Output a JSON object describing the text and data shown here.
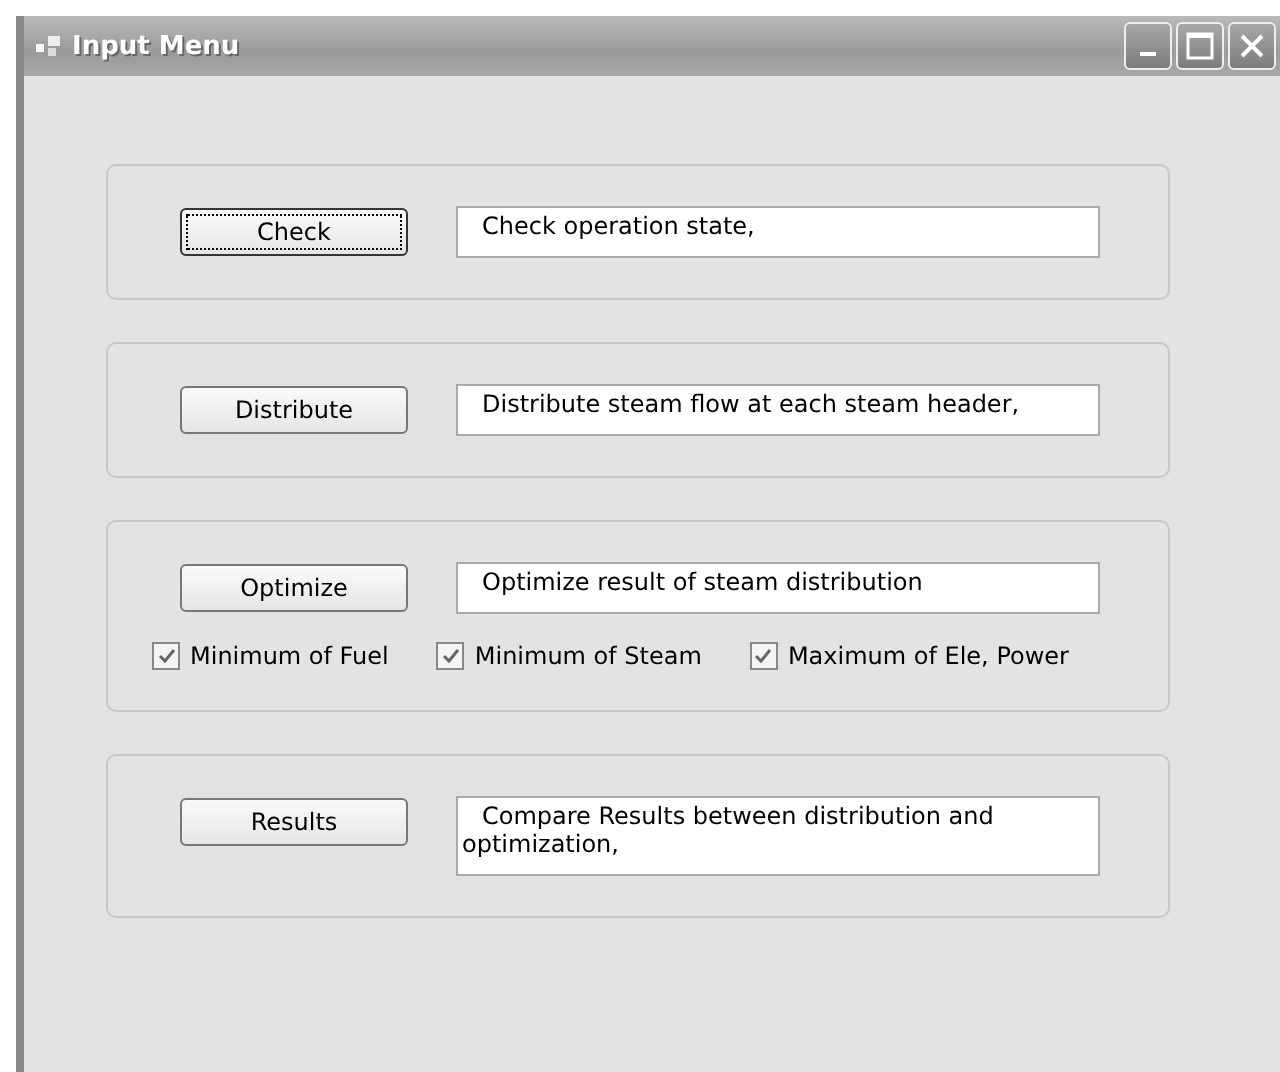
{
  "window": {
    "title": "Input Menu"
  },
  "groups": [
    {
      "button": {
        "label": "Check",
        "focused": true
      },
      "description": "Check operation state,",
      "tall": false
    },
    {
      "button": {
        "label": "Distribute",
        "focused": false
      },
      "description": "Distribute steam flow at each steam header,",
      "tall": false
    },
    {
      "button": {
        "label": "Optimize",
        "focused": false
      },
      "description": "Optimize result of steam distribution",
      "tall": false,
      "options": [
        {
          "label": "Minimum of Fuel",
          "checked": true
        },
        {
          "label": "Minimum of Steam",
          "checked": true
        },
        {
          "label": "Maximum of Ele, Power",
          "checked": true
        }
      ]
    },
    {
      "button": {
        "label": "Results",
        "focused": false
      },
      "description": "Compare Results between distribution and optimization,",
      "tall": true
    }
  ]
}
